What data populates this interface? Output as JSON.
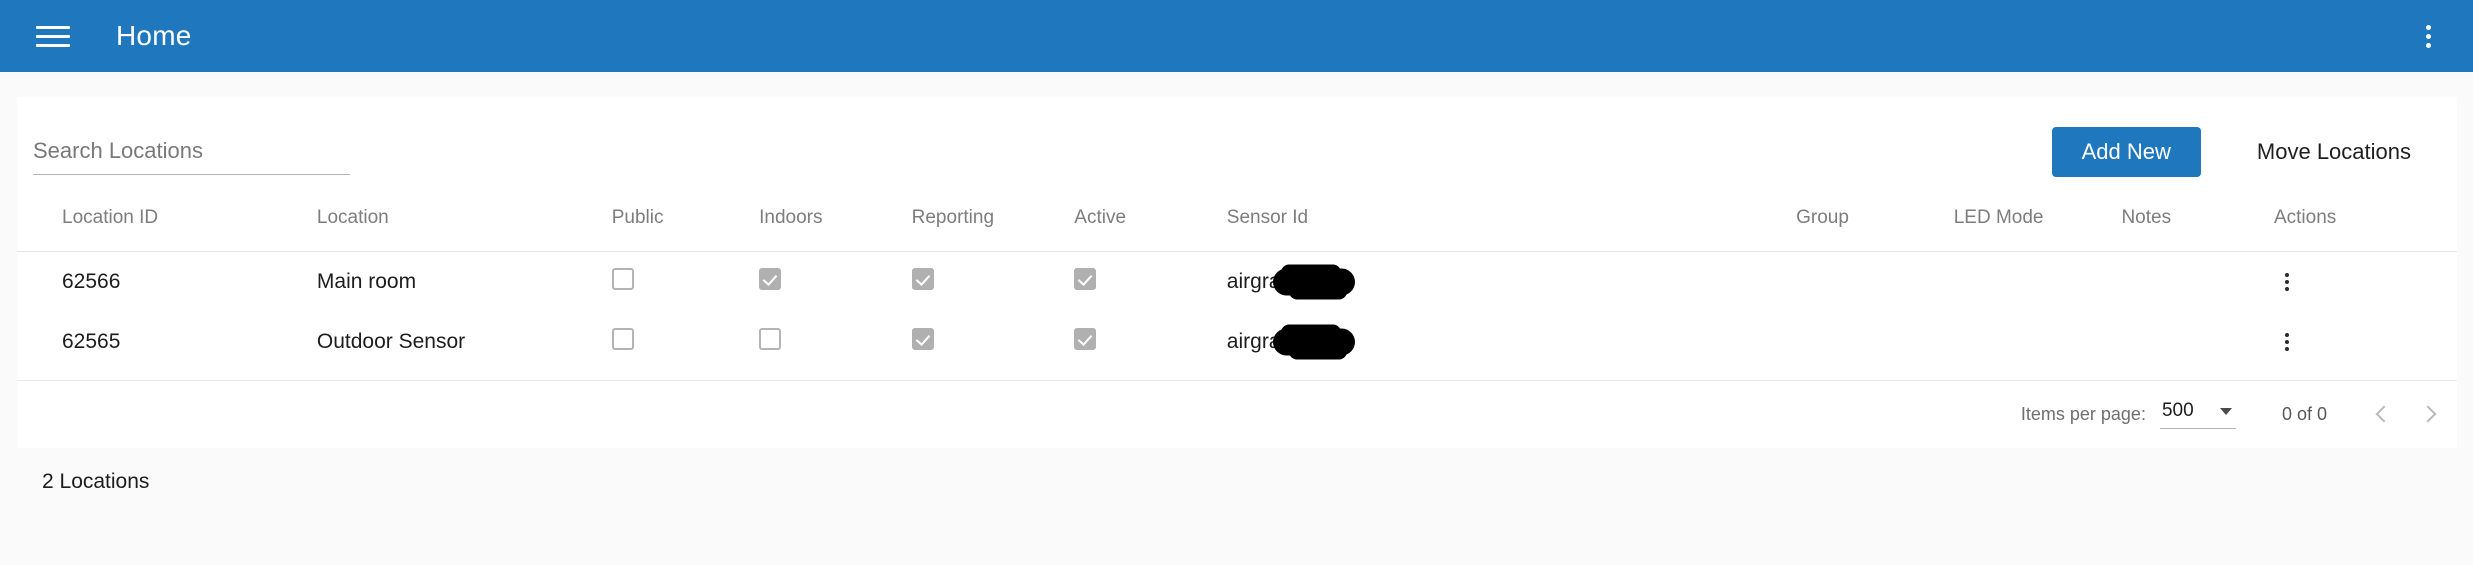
{
  "appbar": {
    "title": "Home",
    "menu_icon": "hamburger-icon",
    "overflow_icon": "more-vert-icon"
  },
  "toolbar": {
    "search_placeholder": "Search Locations",
    "search_value": "",
    "add_new_label": "Add New",
    "move_locations_label": "Move Locations",
    "primary_color": "#1f78be"
  },
  "table": {
    "headers": [
      "Location ID",
      "Location",
      "Public",
      "Indoors",
      "Reporting",
      "Active",
      "Sensor Id",
      "Group",
      "LED Mode",
      "Notes",
      "Actions"
    ],
    "rows": [
      {
        "location_id": "62566",
        "location": "Main room",
        "public": false,
        "indoors": true,
        "reporting": true,
        "active": true,
        "sensor_id": "airgradien",
        "sensor_redacted": true,
        "group": "",
        "led_mode": "",
        "notes": "",
        "actions_icon": "more-vert-icon"
      },
      {
        "location_id": "62565",
        "location": "Outdoor Sensor",
        "public": false,
        "indoors": false,
        "reporting": true,
        "active": true,
        "sensor_id": "airgradien",
        "sensor_redacted": true,
        "group": "",
        "led_mode": "",
        "notes": "",
        "actions_icon": "more-vert-icon"
      }
    ]
  },
  "paginator": {
    "items_per_page_label": "Items per page:",
    "items_per_page_value": "500",
    "range_label": "0 of 0",
    "prev_icon": "chevron-left-icon",
    "next_icon": "chevron-right-icon"
  },
  "footer": {
    "count_label": "2 Locations"
  }
}
